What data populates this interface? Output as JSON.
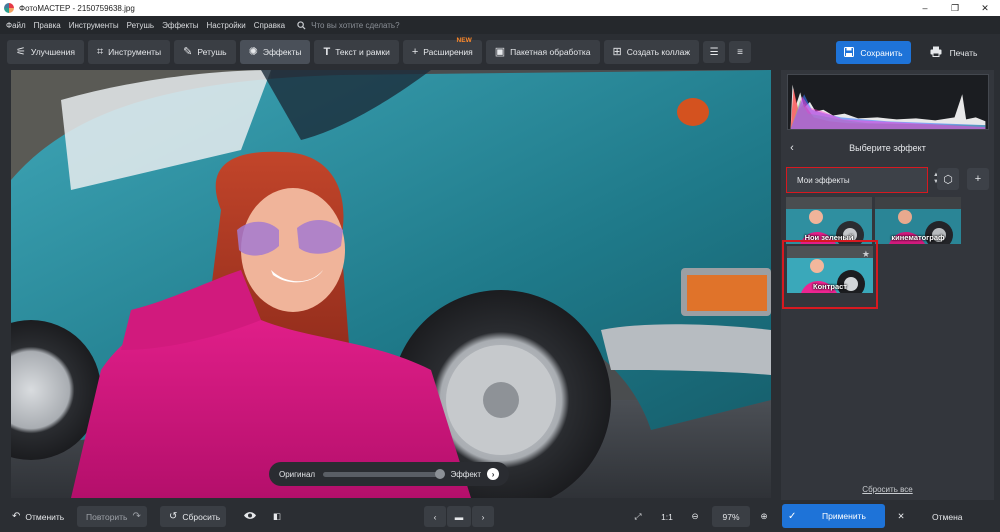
{
  "titlebar": {
    "title": "ФотоМАСТЕР - 2150759638.jpg",
    "minimize": "–",
    "maximize": "❐",
    "close": "✕"
  },
  "menu": {
    "items": [
      "Файл",
      "Правка",
      "Инструменты",
      "Ретушь",
      "Эффекты",
      "Настройки",
      "Справка"
    ],
    "search_placeholder": "Что вы хотите сделать?"
  },
  "toolbar": {
    "tabs": [
      {
        "label": "Улучшения",
        "icon": "sliders-icon"
      },
      {
        "label": "Инструменты",
        "icon": "crop-icon"
      },
      {
        "label": "Ретушь",
        "icon": "brush-icon"
      },
      {
        "label": "Эффекты",
        "icon": "magic-wand-icon"
      },
      {
        "label": "Текст и рамки",
        "icon": "text-icon"
      },
      {
        "label": "Расширения",
        "icon": "plus-icon"
      },
      {
        "label": "Пакетная обработка",
        "icon": "image-stack-icon"
      },
      {
        "label": "Создать коллаж",
        "icon": "collage-icon"
      }
    ],
    "new_badge": "NEW",
    "save_label": "Сохранить",
    "print_label": "Печать"
  },
  "compare": {
    "left_label": "Оригинал",
    "right_label": "Эффект",
    "level": 1.0
  },
  "panel": {
    "title": "Выберите эффект",
    "dropdown_value": "Мои эффекты",
    "effects": [
      {
        "label": "Нои зеленый"
      },
      {
        "label": "кинематограф"
      },
      {
        "label": "Контраст"
      }
    ],
    "reset_all": "Сбросить все"
  },
  "bottombar": {
    "undo": "Отменить",
    "redo": "Повторить",
    "reset": "Сбросить",
    "ratio": "1:1",
    "zoom": "97%",
    "apply": "Применить",
    "cancel": "Отмена"
  },
  "colors": {
    "accent": "#1e73d8",
    "highlight": "#d71920",
    "badge": "#ff8a2b"
  }
}
